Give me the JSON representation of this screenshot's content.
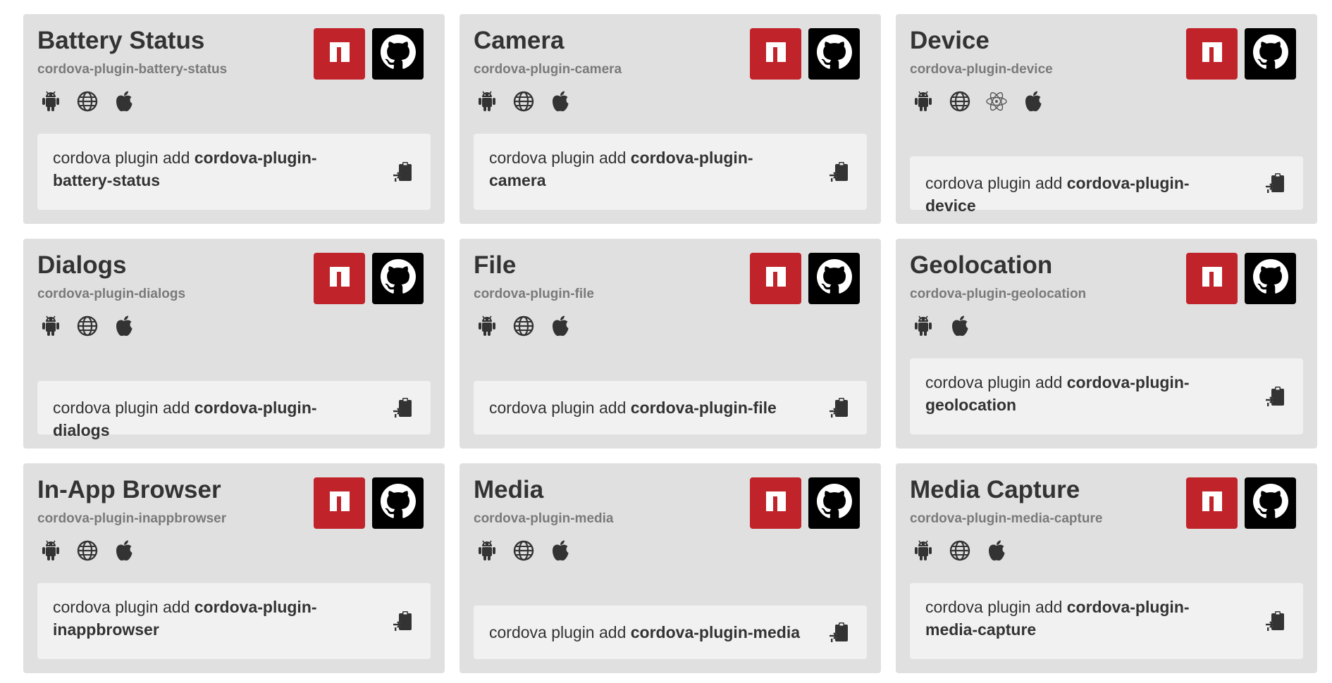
{
  "command_prefix": "cordova plugin add ",
  "colors": {
    "npm": "#c1232b",
    "github": "#000000",
    "card": "#e0e0e0",
    "command_bg": "#f1f1f1"
  },
  "plugins": [
    {
      "name": "Battery Status",
      "package": "cordova-plugin-battery-status",
      "platforms": [
        "android-icon",
        "browser-icon",
        "apple-icon"
      ],
      "wrap": true
    },
    {
      "name": "Camera",
      "package": "cordova-plugin-camera",
      "platforms": [
        "android-icon",
        "browser-icon",
        "apple-icon"
      ],
      "wrap": true
    },
    {
      "name": "Device",
      "package": "cordova-plugin-device",
      "platforms": [
        "android-icon",
        "browser-icon",
        "electron-icon",
        "apple-icon"
      ],
      "wrap": false
    },
    {
      "name": "Dialogs",
      "package": "cordova-plugin-dialogs",
      "platforms": [
        "android-icon",
        "browser-icon",
        "apple-icon"
      ],
      "wrap": false
    },
    {
      "name": "File",
      "package": "cordova-plugin-file",
      "platforms": [
        "android-icon",
        "browser-icon",
        "apple-icon"
      ],
      "wrap": false
    },
    {
      "name": "Geolocation",
      "package": "cordova-plugin-geolocation",
      "platforms": [
        "android-icon",
        "apple-icon"
      ],
      "wrap": true
    },
    {
      "name": "In-App Browser",
      "package": "cordova-plugin-inappbrowser",
      "platforms": [
        "android-icon",
        "browser-icon",
        "apple-icon"
      ],
      "wrap": true
    },
    {
      "name": "Media",
      "package": "cordova-plugin-media",
      "platforms": [
        "android-icon",
        "browser-icon",
        "apple-icon"
      ],
      "wrap": false
    },
    {
      "name": "Media Capture",
      "package": "cordova-plugin-media-capture",
      "platforms": [
        "android-icon",
        "browser-icon",
        "apple-icon"
      ],
      "wrap": true
    }
  ]
}
